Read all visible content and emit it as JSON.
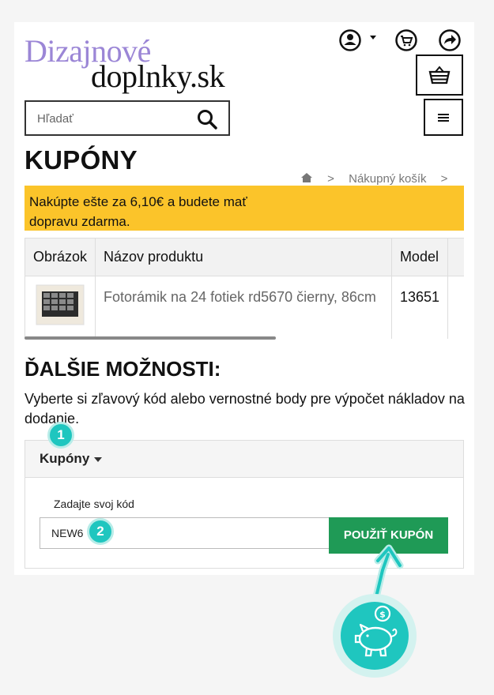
{
  "logo": {
    "line1": "Dizajnové",
    "line2": "doplnky.sk"
  },
  "header_icons": [
    "user-icon",
    "cart-icon",
    "share-icon",
    "basket-icon",
    "hamburger-menu-icon"
  ],
  "search": {
    "placeholder": "Hľadať",
    "icon": "search-icon"
  },
  "page_title": "KUPÓNY",
  "breadcrumb": {
    "home_icon": "home-icon",
    "separator": ">",
    "item": "Nákupný košík",
    "trailing": ">"
  },
  "banner": {
    "text": "Nakúpte ešte za 6,10€ a budete mať dopravu zdarma."
  },
  "table": {
    "headers": [
      "Obrázok",
      "Názov produktu",
      "Model"
    ],
    "rows": [
      {
        "image": "product-thumbnail",
        "name": "Fotorámik na 24 fotiek rd5670 čierny, 86cm",
        "model": "13651"
      }
    ]
  },
  "more_options": {
    "title": "ĎALŠIE MOŽNOSTI:",
    "description": "Vyberte si zľavový kód alebo vernostné body pre výpočet nákladov na dodanie."
  },
  "coupon": {
    "section_label": "Kupóny",
    "field_label": "Zadajte svoj kód",
    "code_value": "NEW6",
    "apply_label": "POUŽIŤ KUPÓN"
  },
  "annotations": {
    "step1": "1",
    "step2": "2",
    "callout_icon": "piggy-bank-icon"
  },
  "colors": {
    "brand_purple": "#9b86d6",
    "banner_yellow": "#fbc42a",
    "apply_green": "#1f9a56",
    "annotation_teal": "#1fc6bf"
  }
}
